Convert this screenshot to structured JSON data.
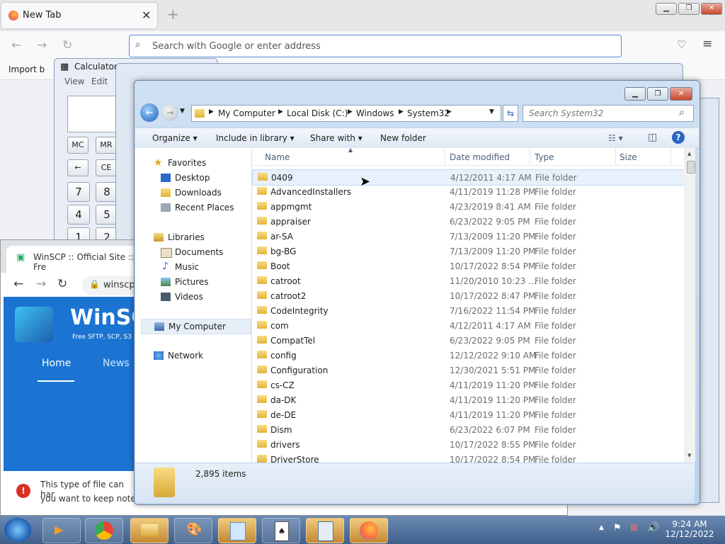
{
  "firefox": {
    "tab_title": "New Tab",
    "address_placeholder": "Search with Google or enter address",
    "bookmark_label": "Import b"
  },
  "calculator": {
    "title": "Calculator",
    "menu": [
      "View",
      "Edit"
    ],
    "mem_buttons": [
      "MC",
      "MR"
    ],
    "row2": [
      "←",
      "CE"
    ],
    "digits": [
      "7",
      "8",
      "4",
      "5",
      "1",
      "2"
    ]
  },
  "chrome": {
    "tab_title": "WinSCP :: Official Site :: Fre",
    "url": "winscp",
    "brand": "WinSC",
    "tagline": "Free SFTP, SCP, S3 a",
    "nav": [
      "Home",
      "News"
    ],
    "warning": "This type of file can har",
    "warning2": "you want to keep note"
  },
  "explorer": {
    "breadcrumb": [
      "My Computer",
      "Local Disk (C:)",
      "Windows",
      "System32"
    ],
    "search_placeholder": "Search System32",
    "commands": [
      "Organize ▾",
      "Include in library ▾",
      "Share with ▾",
      "New folder"
    ],
    "nav": {
      "favorites": "Favorites",
      "fav_items": [
        "Desktop",
        "Downloads",
        "Recent Places"
      ],
      "libraries": "Libraries",
      "lib_items": [
        "Documents",
        "Music",
        "Pictures",
        "Videos"
      ],
      "computer": "My Computer",
      "network": "Network"
    },
    "columns": [
      "Name",
      "Date modified",
      "Type",
      "Size"
    ],
    "files": [
      {
        "name": "0409",
        "date": "4/12/2011 4:17 AM",
        "type": "File folder"
      },
      {
        "name": "AdvancedInstallers",
        "date": "4/11/2019 11:28 PM",
        "type": "File folder"
      },
      {
        "name": "appmgmt",
        "date": "4/23/2019 8:41 AM",
        "type": "File folder"
      },
      {
        "name": "appraiser",
        "date": "6/23/2022 9:05 PM",
        "type": "File folder"
      },
      {
        "name": "ar-SA",
        "date": "7/13/2009 11:20 PM",
        "type": "File folder"
      },
      {
        "name": "bg-BG",
        "date": "7/13/2009 11:20 PM",
        "type": "File folder"
      },
      {
        "name": "Boot",
        "date": "10/17/2022 8:54 PM",
        "type": "File folder"
      },
      {
        "name": "catroot",
        "date": "11/20/2010 10:23 ...",
        "type": "File folder"
      },
      {
        "name": "catroot2",
        "date": "10/17/2022 8:47 PM",
        "type": "File folder"
      },
      {
        "name": "CodeIntegrity",
        "date": "7/16/2022 11:54 PM",
        "type": "File folder"
      },
      {
        "name": "com",
        "date": "4/12/2011 4:17 AM",
        "type": "File folder"
      },
      {
        "name": "CompatTel",
        "date": "6/23/2022 9:05 PM",
        "type": "File folder"
      },
      {
        "name": "config",
        "date": "12/12/2022 9:10 AM",
        "type": "File folder"
      },
      {
        "name": "Configuration",
        "date": "12/30/2021 5:51 PM",
        "type": "File folder"
      },
      {
        "name": "cs-CZ",
        "date": "4/11/2019 11:20 PM",
        "type": "File folder"
      },
      {
        "name": "da-DK",
        "date": "4/11/2019 11:20 PM",
        "type": "File folder"
      },
      {
        "name": "de-DE",
        "date": "4/11/2019 11:20 PM",
        "type": "File folder"
      },
      {
        "name": "Dism",
        "date": "6/23/2022 6:07 PM",
        "type": "File folder"
      },
      {
        "name": "drivers",
        "date": "10/17/2022 8:55 PM",
        "type": "File folder"
      },
      {
        "name": "DriverStore",
        "date": "10/17/2022 8:54 PM",
        "type": "File folder"
      }
    ],
    "status": "2,895 items"
  },
  "taskbar": {
    "time": "9:24 AM",
    "date": "12/12/2022"
  }
}
